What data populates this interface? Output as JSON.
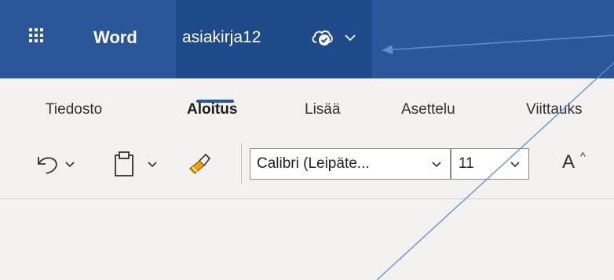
{
  "titlebar": {
    "app_name": "Word",
    "doc_name": "asiakirja12",
    "icons": [
      "waffle-icon",
      "cloud-saved-icon",
      "chevron-down-icon"
    ]
  },
  "tabs": [
    {
      "label": "Tiedosto",
      "active": false
    },
    {
      "label": "Aloitus",
      "active": true
    },
    {
      "label": "Lisää",
      "active": false
    },
    {
      "label": "Asettelu",
      "active": false
    },
    {
      "label": "Viittauks",
      "active": false
    }
  ],
  "toolbar": {
    "font_name": "Calibri (Leipäte...",
    "font_size": "11",
    "grow_font_label": "A",
    "icons": [
      "undo-icon",
      "paste-icon",
      "format-painter-icon",
      "grow-font-icon"
    ]
  },
  "colors": {
    "title_bar": "#2b579a",
    "doc_area": "#1f4a8a",
    "ribbon": "#f3f2f1",
    "accent": "#2b579a",
    "annotation": "#5b8fd9",
    "format_painter": "#f0a30a"
  }
}
